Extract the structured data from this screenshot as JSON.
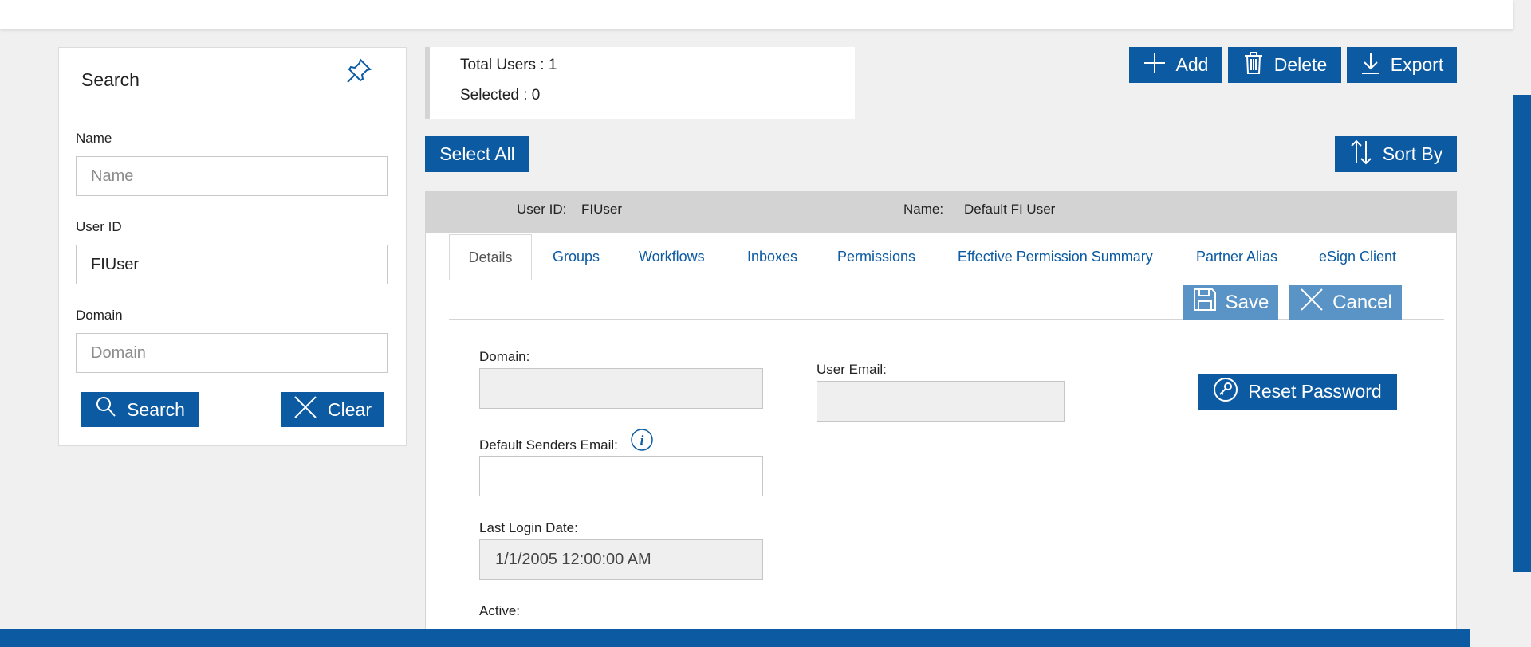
{
  "search": {
    "title": "Search",
    "name_label": "Name",
    "name_placeholder": "Name",
    "userid_label": "User ID",
    "userid_value": "FIUser",
    "domain_label": "Domain",
    "domain_placeholder": "Domain",
    "search_button": "Search",
    "clear_button": "Clear"
  },
  "summary": {
    "total_users": "Total Users : 1",
    "selected": "Selected : 0"
  },
  "toolbar": {
    "add": "Add",
    "delete": "Delete",
    "export": "Export",
    "select_all": "Select All",
    "sort_by": "Sort By"
  },
  "record": {
    "userid_label": "User ID:",
    "userid_value": "FIUser",
    "name_label": "Name:",
    "name_value": "Default FI User"
  },
  "tabs": [
    "Details",
    "Groups",
    "Workflows",
    "Inboxes",
    "Permissions",
    "Effective Permission Summary",
    "Partner Alias",
    "eSign Client"
  ],
  "actions": {
    "save": "Save",
    "cancel": "Cancel",
    "reset_password": "Reset Password"
  },
  "details": {
    "domain_label": "Domain:",
    "domain_value": "",
    "user_email_label": "User Email:",
    "user_email_value": "",
    "default_senders_email_label": "Default Senders Email:",
    "default_senders_email_value": "",
    "last_login_label": "Last Login Date:",
    "last_login_value": "1/1/2005 12:00:00 AM",
    "active_label": "Active:"
  },
  "colors": {
    "primary": "#0b5aa2",
    "primary_light": "#5a94c6",
    "header_gray": "#d3d3d3",
    "page_bg": "#f0f0f0"
  }
}
